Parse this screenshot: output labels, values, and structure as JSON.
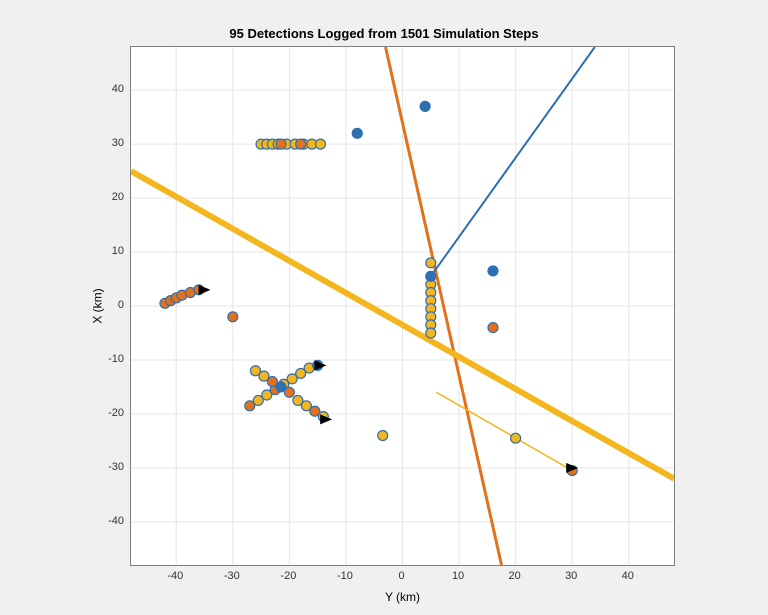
{
  "chart_data": {
    "type": "scatter",
    "title": "95 Detections Logged from 1501 Simulation Steps",
    "xlabel": "Y (km)",
    "ylabel": "X (km)",
    "xlim": [
      -48,
      48
    ],
    "ylim": [
      -48,
      48
    ],
    "xticks": [
      -40,
      -30,
      -20,
      -10,
      0,
      10,
      20,
      30,
      40
    ],
    "yticks": [
      -40,
      -30,
      -20,
      -10,
      0,
      10,
      20,
      30,
      40
    ],
    "series": [
      {
        "name": "track-orange",
        "type": "line",
        "color": "#E2711D",
        "width": 3,
        "points": [
          [
            -3,
            48
          ],
          [
            17.5,
            -48
          ]
        ]
      },
      {
        "name": "track-yellow-thick",
        "type": "line",
        "color": "#F3B61F",
        "width": 6,
        "points": [
          [
            -48,
            25
          ],
          [
            48,
            -32
          ]
        ]
      },
      {
        "name": "track-yellow-thin",
        "type": "line",
        "color": "#F3B61F",
        "width": 1.5,
        "points": [
          [
            6,
            -16
          ],
          [
            30,
            -30.5
          ]
        ]
      },
      {
        "name": "track-blue",
        "type": "line",
        "color": "#2E6FB4",
        "width": 2,
        "points": [
          [
            5,
            5.5
          ],
          [
            34,
            48
          ]
        ]
      },
      {
        "name": "row-30",
        "type": "points",
        "color": "#F3B61F",
        "edge": "#2E6FB4",
        "pts": [
          [
            -25,
            30
          ],
          [
            -24,
            30
          ],
          [
            -23,
            30
          ],
          [
            -22,
            30
          ],
          [
            -20.5,
            30
          ],
          [
            -19,
            30
          ],
          [
            -17.5,
            30
          ],
          [
            -16,
            30
          ],
          [
            -14.5,
            30
          ]
        ]
      },
      {
        "name": "row-30-orange",
        "type": "points",
        "color": "#E2711D",
        "edge": "#2E6FB4",
        "pts": [
          [
            -21.5,
            30
          ],
          [
            -18,
            30
          ]
        ]
      },
      {
        "name": "col-5",
        "type": "points",
        "color": "#F3B61F",
        "edge": "#2E6FB4",
        "pts": [
          [
            5,
            8
          ],
          [
            5,
            4
          ],
          [
            5,
            2.5
          ],
          [
            5,
            1
          ],
          [
            5,
            -0.5
          ],
          [
            5,
            -2
          ],
          [
            5,
            -3.5
          ],
          [
            5,
            -5
          ]
        ]
      },
      {
        "name": "col-5-blue",
        "type": "points",
        "color": "#2E6FB4",
        "edge": "#2E6FB4",
        "pts": [
          [
            5,
            5.5
          ]
        ]
      },
      {
        "name": "cluster-40",
        "type": "points",
        "color": "#E2711D",
        "edge": "#2E6FB4",
        "pts": [
          [
            -42,
            0.5
          ],
          [
            -41,
            1
          ],
          [
            -40,
            1.5
          ],
          [
            -39,
            2
          ],
          [
            -37.5,
            2.5
          ],
          [
            -36,
            3
          ]
        ]
      },
      {
        "name": "cluster-40-arrow",
        "type": "arrow",
        "at": [
          -35,
          3
        ]
      },
      {
        "name": "cross",
        "type": "points",
        "color": "mix",
        "edge": "#2E6FB4",
        "pts": [
          [
            -27,
            -18.5,
            "#E2711D"
          ],
          [
            -25.5,
            -17.5,
            "#F3B61F"
          ],
          [
            -24,
            -16.5,
            "#F3B61F"
          ],
          [
            -22.5,
            -15.5,
            "#E2711D"
          ],
          [
            -21,
            -14.5,
            "#F3B61F"
          ],
          [
            -19.5,
            -13.5,
            "#F3B61F"
          ],
          [
            -18,
            -12.5,
            "#F3B61F"
          ],
          [
            -16.5,
            -11.5,
            "#F3B61F"
          ],
          [
            -15,
            -11,
            "#2E6FB4"
          ],
          [
            -26,
            -12,
            "#F3B61F"
          ],
          [
            -24.5,
            -13,
            "#F3B61F"
          ],
          [
            -23,
            -14,
            "#E2711D"
          ],
          [
            -21.5,
            -15,
            "#2E6FB4"
          ],
          [
            -20,
            -16,
            "#E2711D"
          ],
          [
            -18.5,
            -17.5,
            "#F3B61F"
          ],
          [
            -17,
            -18.5,
            "#F3B61F"
          ],
          [
            -15.5,
            -19.5,
            "#E2711D"
          ],
          [
            -14,
            -20.5,
            "#F3B61F"
          ]
        ]
      },
      {
        "name": "cross-arrow1",
        "type": "arrow",
        "at": [
          -14.5,
          -11
        ]
      },
      {
        "name": "cross-arrow2",
        "type": "arrow",
        "at": [
          -13.5,
          -21
        ]
      },
      {
        "name": "iso-blue",
        "type": "points",
        "color": "#2E6FB4",
        "edge": "#2E6FB4",
        "pts": [
          [
            4,
            37
          ],
          [
            -8,
            32
          ],
          [
            16,
            6.5
          ]
        ]
      },
      {
        "name": "iso-orange",
        "type": "points",
        "color": "#E2711D",
        "edge": "#2E6FB4",
        "pts": [
          [
            -30,
            -2
          ],
          [
            16,
            -4
          ],
          [
            30,
            -30.5
          ]
        ]
      },
      {
        "name": "iso-yellow",
        "type": "points",
        "color": "#F3B61F",
        "edge": "#2E6FB4",
        "pts": [
          [
            -3.5,
            -24
          ],
          [
            20,
            -24.5
          ]
        ]
      },
      {
        "name": "iso-arrow",
        "type": "arrow",
        "at": [
          30,
          -30
        ]
      }
    ]
  }
}
